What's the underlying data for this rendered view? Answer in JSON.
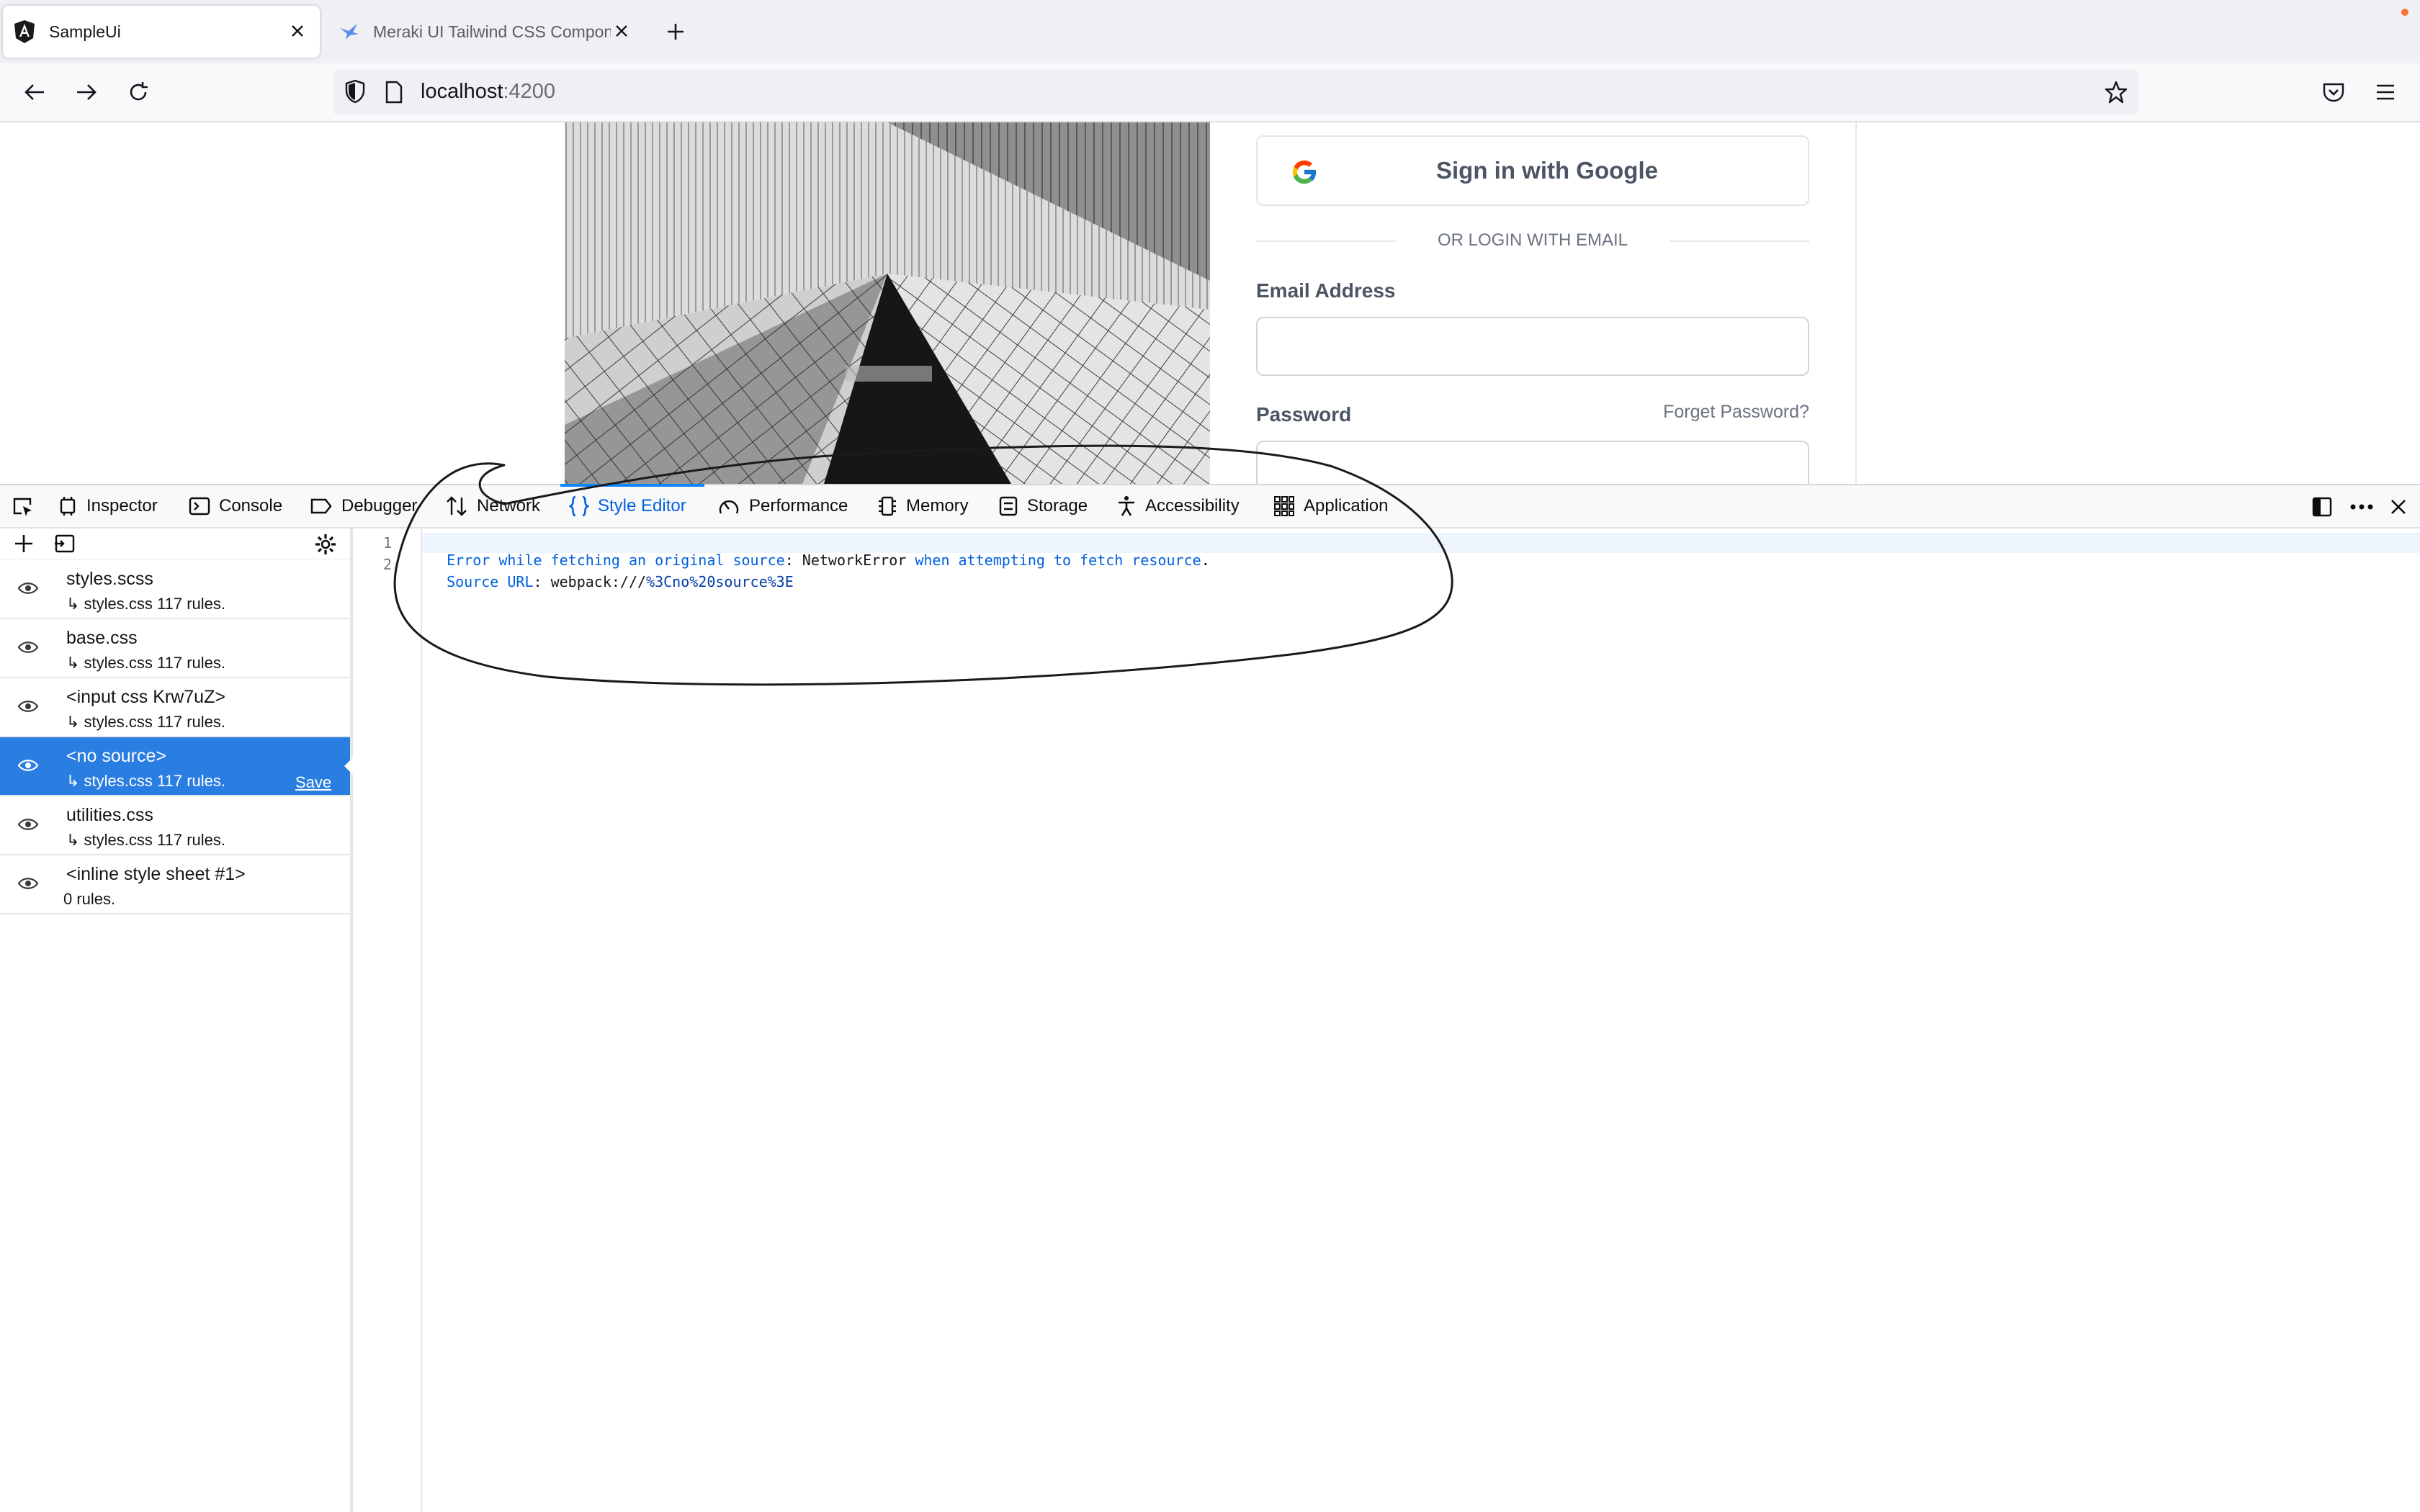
{
  "browser": {
    "tabs": [
      {
        "title": "SampleUi",
        "active": true,
        "icon": "angular-icon"
      },
      {
        "title": "Meraki UI Tailwind CSS Compon",
        "active": false,
        "icon": "meraki-bird-icon"
      }
    ],
    "url_host": "localhost",
    "url_port": ":4200"
  },
  "page": {
    "google_button": "Sign in with Google",
    "divider_text": "OR LOGIN WITH EMAIL",
    "email_label": "Email Address",
    "password_label": "Password",
    "forgot_link": "Forget Password?"
  },
  "devtools": {
    "tabs": [
      {
        "label": "Inspector",
        "icon": "inspector-icon"
      },
      {
        "label": "Console",
        "icon": "console-icon"
      },
      {
        "label": "Debugger",
        "icon": "debugger-icon"
      },
      {
        "label": "Network",
        "icon": "network-icon"
      },
      {
        "label": "Style Editor",
        "icon": "braces-icon",
        "selected": true
      },
      {
        "label": "Performance",
        "icon": "gauge-icon"
      },
      {
        "label": "Memory",
        "icon": "memory-icon"
      },
      {
        "label": "Storage",
        "icon": "storage-icon"
      },
      {
        "label": "Accessibility",
        "icon": "accessibility-icon"
      },
      {
        "label": "Application",
        "icon": "grid-icon"
      }
    ],
    "stylesheets": [
      {
        "name": "styles.scss",
        "rules": "↳ styles.css 117 rules."
      },
      {
        "name": "base.css",
        "rules": "↳ styles.css 117 rules."
      },
      {
        "name": "<input css Krw7uZ>",
        "rules": "↳ styles.css 117 rules."
      },
      {
        "name": "<no source>",
        "rules": "↳ styles.css 117 rules.",
        "selected": true,
        "save": "Save"
      },
      {
        "name": "utilities.css",
        "rules": "↳ styles.css 117 rules."
      },
      {
        "name": "<inline style sheet #1>",
        "rules": "0 rules."
      }
    ],
    "editor": {
      "line_numbers": [
        "1",
        "2"
      ],
      "line1": {
        "a": "Error while fetching an original source",
        "b": ": NetworkError ",
        "c": "when attempting to fetch resource",
        "d": "."
      },
      "line2": {
        "a": "Source URL",
        "b": ": webpack:///",
        "c": "%3Cno%20source%3E"
      }
    }
  },
  "colors": {
    "accent": "#0060df",
    "selected_row": "#2a7de1"
  }
}
